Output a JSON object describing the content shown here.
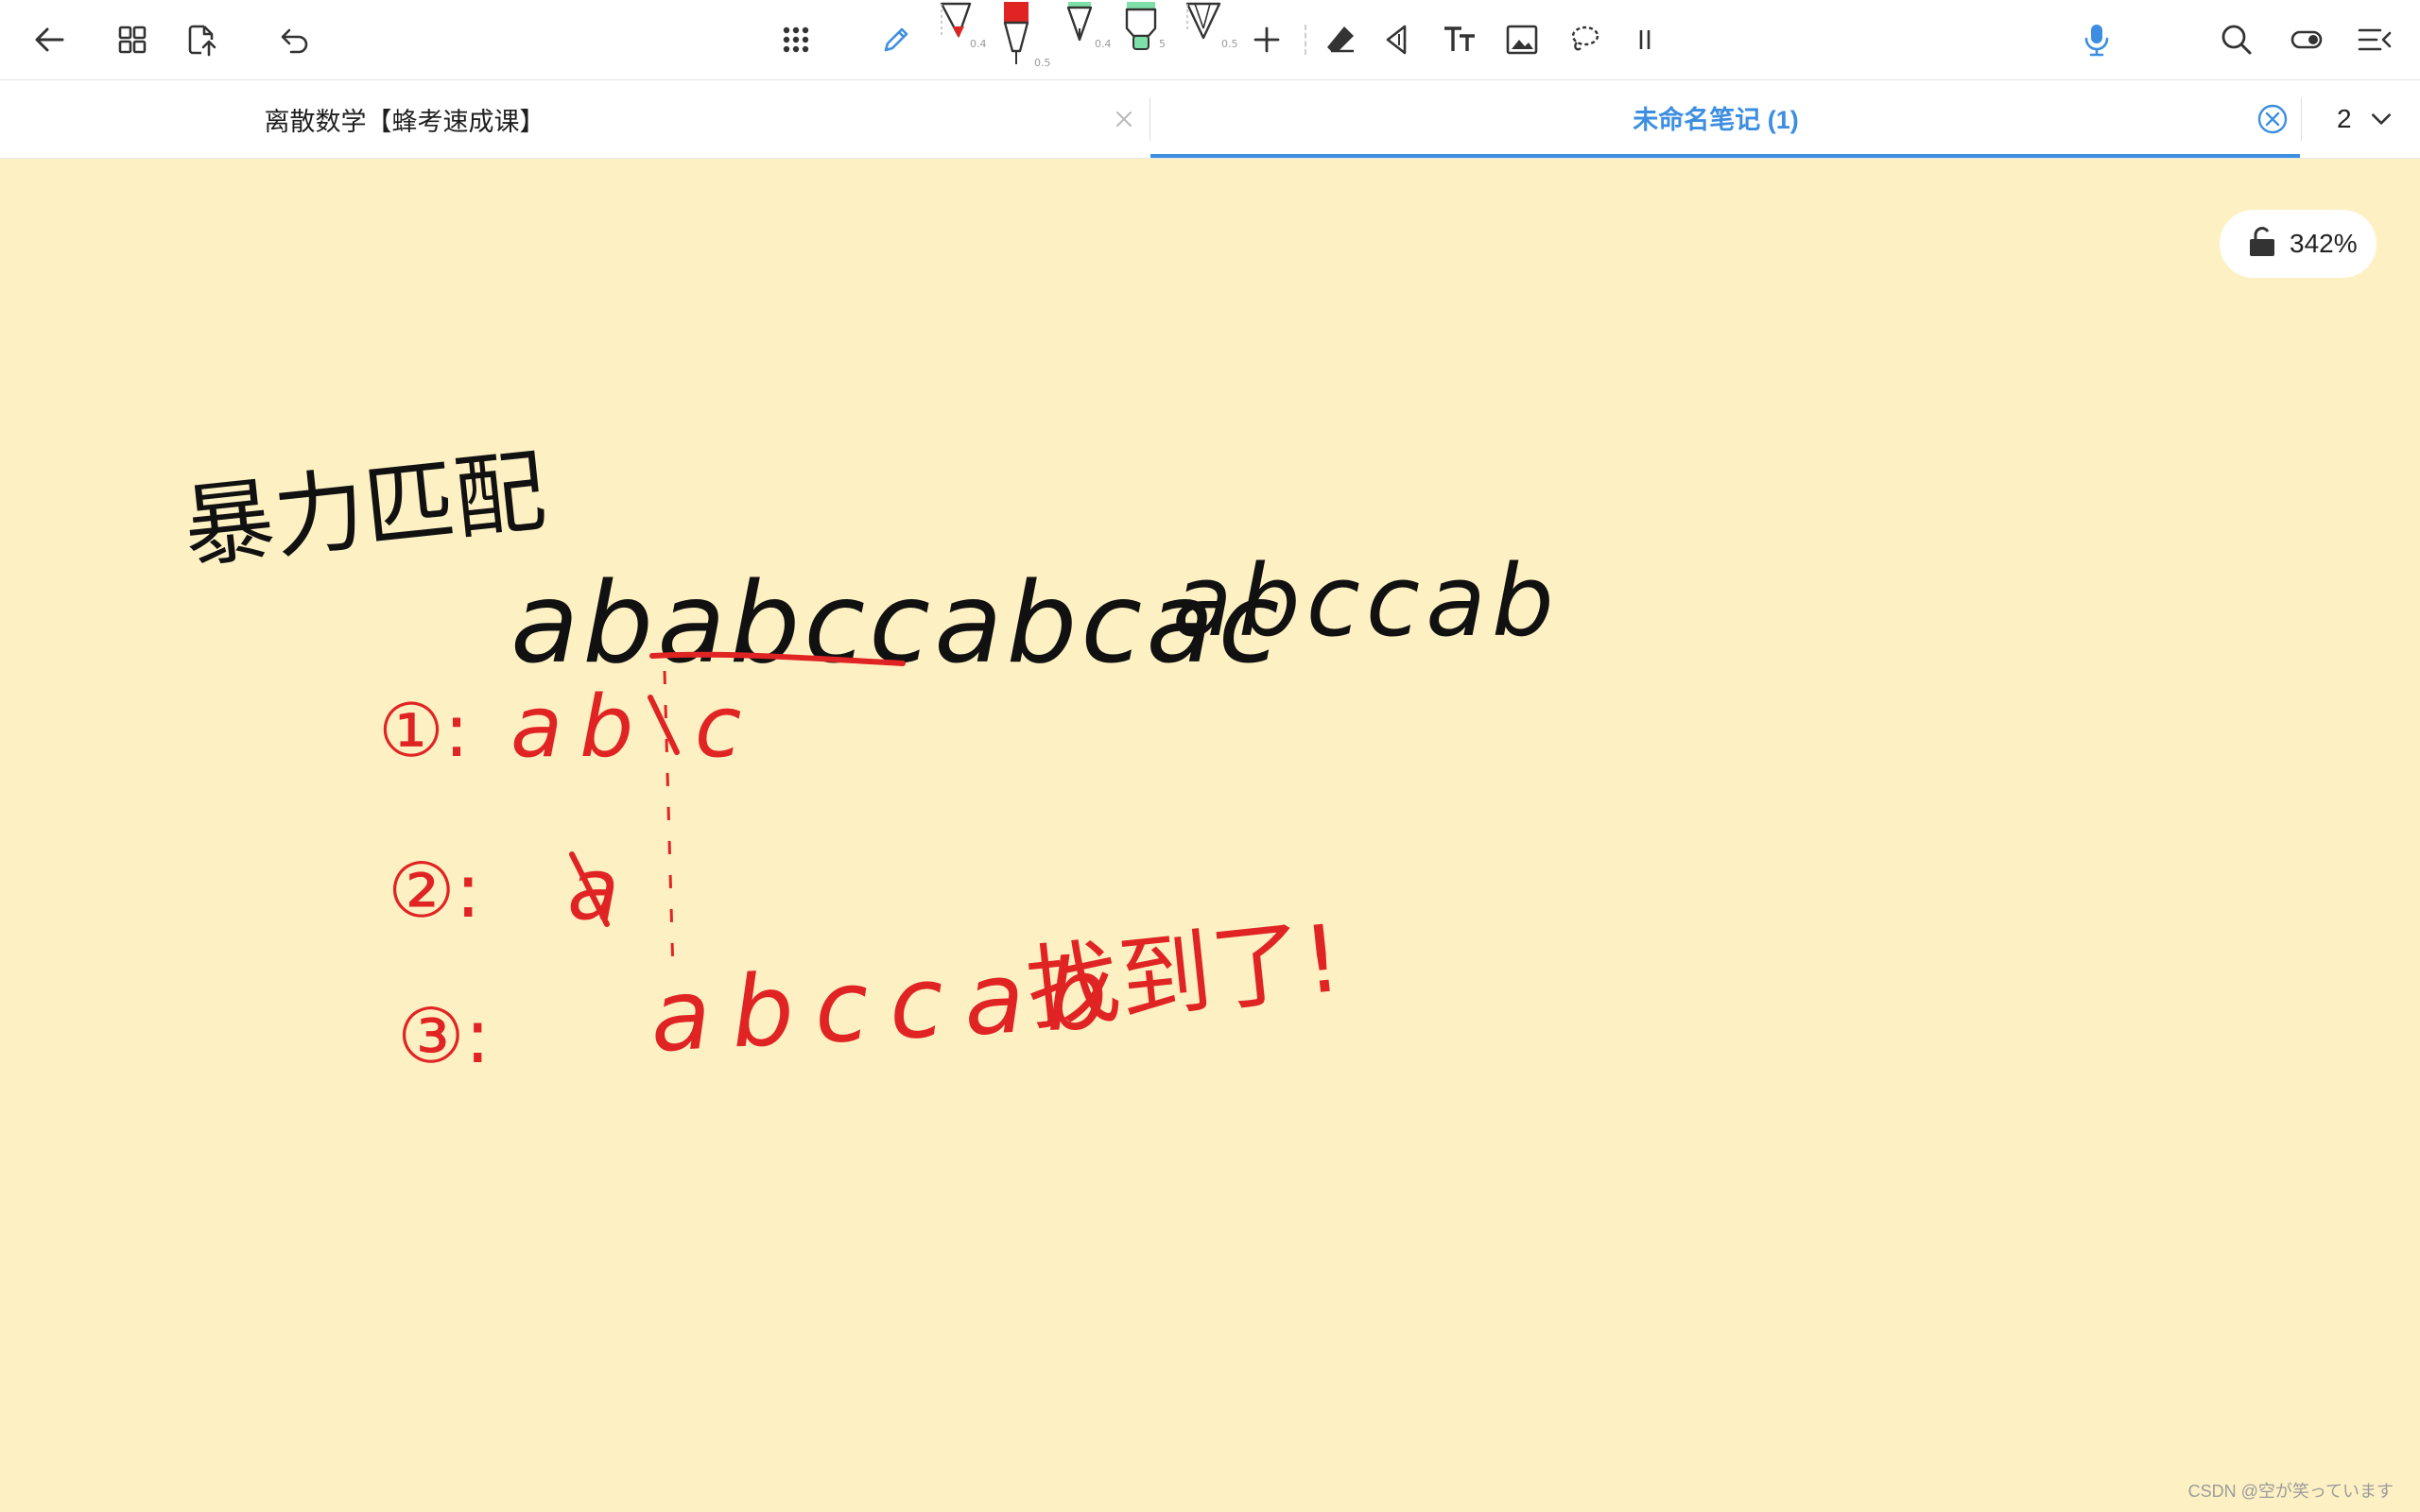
{
  "tabs": [
    {
      "label": "离散数学【蜂考速成课】",
      "active": false
    },
    {
      "label": "未命名笔记 (1)",
      "active": true
    }
  ],
  "page_indicator": "2",
  "zoom": {
    "value": "342%",
    "locked": false
  },
  "toolbar": {
    "left_icons": [
      "back-arrow-icon",
      "grid-view-icon",
      "export-icon",
      "undo-icon"
    ],
    "center_icons": [
      "apps-grid-icon",
      "pencil-icon",
      "pen-red-icon",
      "marker-red-icon",
      "fountain-pen-green-icon",
      "highlighter-green-icon",
      "pen-black-icon",
      "add-icon",
      "eraser-icon",
      "shape-icon",
      "text-icon",
      "image-icon",
      "lasso-icon",
      "pause-icon"
    ],
    "right_icons": [
      "microphone-icon",
      "search-icon",
      "toggle-icon",
      "menu-collapse-icon"
    ],
    "pen_sizes": [
      "0.4",
      "0.5",
      "0.4",
      "5",
      "0.5"
    ],
    "accent_color": "#3d8ee0",
    "pen_colors": [
      "#e02424",
      "#e02424",
      "#111111",
      "#7ee0a8",
      "#111111"
    ]
  },
  "canvas": {
    "background": "#fdf1c4",
    "handwriting": {
      "title": "暴力匹配",
      "text_string": "ababccabcac",
      "pattern_string": "abccab",
      "step1_marker": "①:",
      "step1_text": "ab c",
      "step2_marker": "②:",
      "step2_text": "a",
      "step3_marker": "③:",
      "step3_text": "abccab",
      "step3_note": "找到了!"
    }
  },
  "watermark": "CSDN @空が笑っています"
}
